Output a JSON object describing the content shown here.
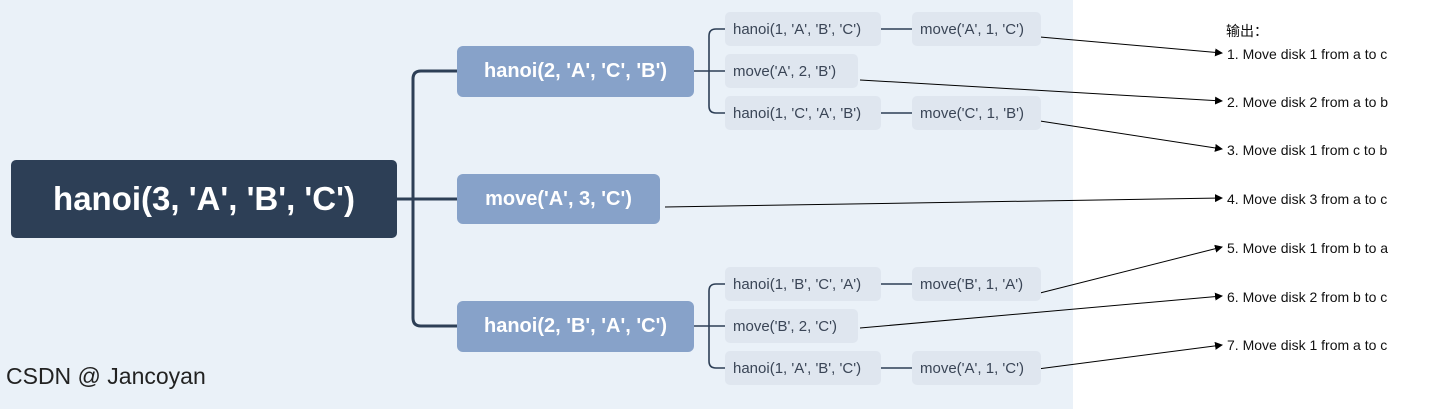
{
  "root": {
    "label": "hanoi(3, 'A', 'B', 'C')"
  },
  "mid": [
    {
      "label": "hanoi(2, 'A', 'C', 'B')"
    },
    {
      "label": "move('A', 3, 'C')"
    },
    {
      "label": "hanoi(2, 'B', 'A', 'C')"
    }
  ],
  "leaves": [
    {
      "label": "hanoi(1, 'A', 'B', 'C')"
    },
    {
      "label": "move('A', 1, 'C')"
    },
    {
      "label": "move('A', 2, 'B')"
    },
    {
      "label": "hanoi(1, 'C', 'A', 'B')"
    },
    {
      "label": "move('C', 1, 'B')"
    },
    {
      "label": "hanoi(1, 'B', 'C', 'A')"
    },
    {
      "label": "move('B', 1, 'A')"
    },
    {
      "label": "move('B', 2, 'C')"
    },
    {
      "label": "hanoi(1, 'A', 'B', 'C')"
    },
    {
      "label": "move('A', 1, 'C')"
    }
  ],
  "output": {
    "title": "输出：",
    "lines": [
      "1. Move disk 1 from a to c",
      "2. Move disk 2 from a to b",
      "3. Move disk 1 from c to b",
      "4. Move disk 3 from a to c",
      "5. Move disk 1 from b to a",
      "6. Move disk 2 from b to c",
      "7. Move disk 1 from a to c"
    ]
  },
  "watermark": "CSDN @ Jancoyan",
  "colors": {
    "root_bg": "#2d3f56",
    "mid_bg": "#87a2c9",
    "leaf_bg": "#dfe6ef",
    "connector": "#2d3f56",
    "canvas_bg": "#eaf1f8"
  }
}
